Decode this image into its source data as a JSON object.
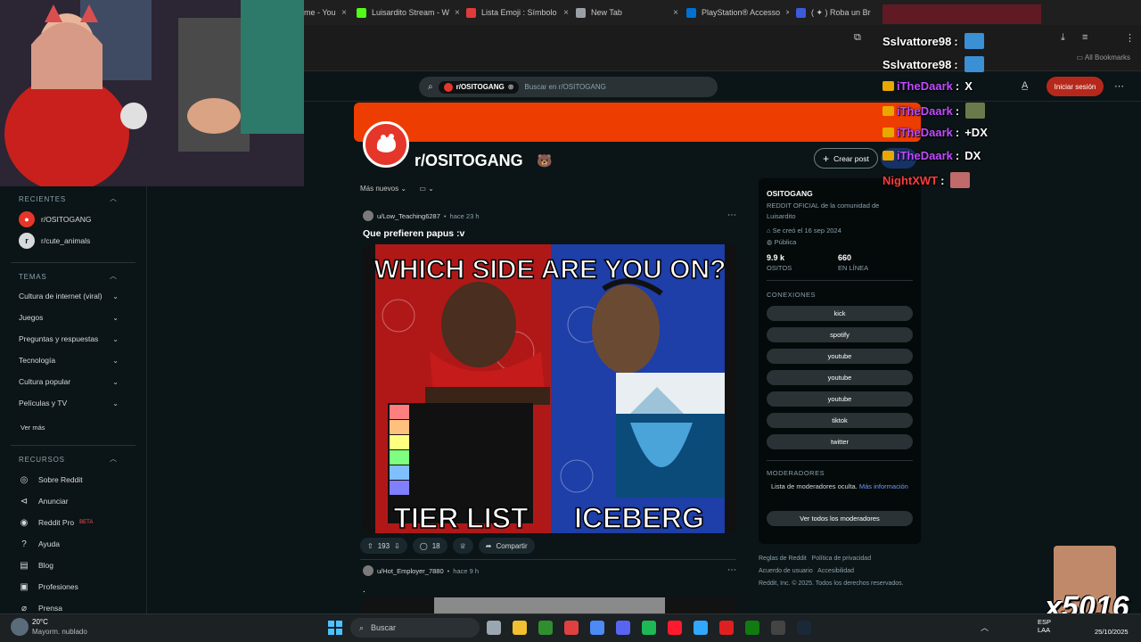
{
  "browser": {
    "tabs": [
      {
        "label": "me - You",
        "color": "#ff0000"
      },
      {
        "label": "Luisardito Stream - W",
        "color": "#53fc18"
      },
      {
        "label": "Lista Emoji : Símbolo",
        "color": "#e03a3a"
      },
      {
        "label": "New Tab",
        "color": "#9aa0a6"
      },
      {
        "label": "PlayStation® Accesso",
        "color": "#0070d1"
      },
      {
        "label": "( ✦ ) Roba un Br",
        "color": "#3b5bdb"
      }
    ],
    "bookmarks_label": "All Bookmarks"
  },
  "reddit": {
    "search": {
      "chip": "r/OSITOGANG",
      "placeholder": "Buscar en r/OSITOGANG"
    },
    "login_label": "Iniciar sesión",
    "subreddit_name": "r/OSITOGANG",
    "create_post_label": "Crear post",
    "sort_label": "Más nuevos",
    "sidebar": {
      "recent_title": "RECIENTES",
      "recent": [
        {
          "label": "r/OSITOGANG",
          "color": "#e5362a"
        },
        {
          "label": "r/cute_animals",
          "color": "#d7dadc"
        }
      ],
      "topics_title": "TEMAS",
      "topics": [
        "Cultura de internet (viral)",
        "Juegos",
        "Preguntas y respuestas",
        "Tecnología",
        "Cultura popular",
        "Películas y TV"
      ],
      "see_more": "Ver más",
      "resources_title": "RECURSOS",
      "resources": [
        {
          "label": "Sobre Reddit",
          "icon": "info-icon"
        },
        {
          "label": "Anunciar",
          "icon": "megaphone-icon"
        },
        {
          "label": "Reddit Pro",
          "icon": "pro-icon",
          "badge": "BETA"
        },
        {
          "label": "Ayuda",
          "icon": "help-icon"
        },
        {
          "label": "Blog",
          "icon": "book-icon"
        },
        {
          "label": "Profesiones",
          "icon": "briefcase-icon"
        },
        {
          "label": "Prensa",
          "icon": "mic-icon"
        }
      ]
    },
    "posts": [
      {
        "author": "u/Low_Teaching6287",
        "time": "hace 23 h",
        "title": "Que prefieren papus :v",
        "image_top_text": "WHICH SIDE ARE YOU ON?",
        "image_left_text": "TIER LIST",
        "image_right_text": "ICEBERG",
        "votes": "193",
        "comments": "18",
        "share_label": "Compartir"
      },
      {
        "author": "u/Hot_Employer_7880",
        "time": "hace 9 h",
        "title": "."
      }
    ],
    "about": {
      "name": "OSITOGANG",
      "description": "REDDIT OFICIAL de la comunidad de Luisardito",
      "created": "Se creó el 16 sep 2024",
      "visibility": "Pública",
      "members_value": "9.9 k",
      "members_label": "OSITOS",
      "online_value": "660",
      "online_label": "EN LÍNEA",
      "connections_title": "CONEXIONES",
      "connections": [
        "kick",
        "spotify",
        "youtube",
        "youtube",
        "youtube",
        "tiktok",
        "twitter"
      ],
      "mods_title": "MODERADORES",
      "mods_hidden": "Lista de moderadores oculta.",
      "mods_more": "Más información",
      "mods_button": "Ver todos los moderadores",
      "footer_links": [
        "Reglas de Reddit",
        "Política de privacidad",
        "Acuerdo de usuario",
        "Accesibilidad"
      ],
      "copyright": "Reddit, Inc. © 2025. Todos los derechos reservados."
    }
  },
  "chat": [
    {
      "user": "Sslvattore98",
      "text": "",
      "color": "#ffffff",
      "crown": false
    },
    {
      "user": "Sslvattore98",
      "text": "",
      "color": "#ffffff",
      "crown": false
    },
    {
      "user": "iTheDaark",
      "text": "X",
      "color": "#c04cff",
      "crown": true
    },
    {
      "user": "iTheDaark",
      "text": "",
      "color": "#c04cff",
      "crown": true
    },
    {
      "user": "iTheDaark",
      "text": "+DX",
      "color": "#c04cff",
      "crown": true
    },
    {
      "user": "iTheDaark",
      "text": "DX",
      "color": "#c04cff",
      "crown": true
    },
    {
      "user": "NightXWT",
      "text": "",
      "color": "#ff3b3b",
      "crown": false
    }
  ],
  "overlay_number": "x5016",
  "taskbar": {
    "weather_temp": "20°C",
    "weather_desc": "Mayorm. nublado",
    "search_label": "Buscar",
    "lang": "ESP",
    "lang2": "LAA",
    "date": "25/10/2025"
  }
}
